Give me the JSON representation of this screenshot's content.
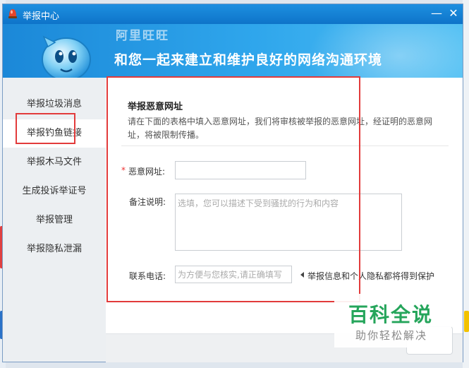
{
  "window": {
    "title": "举报中心",
    "minimize_glyph": "—",
    "close_glyph": "✕"
  },
  "banner": {
    "line1_partial": "阿里旺旺",
    "slogan": "和您一起来建立和维护良好的网络沟通环境"
  },
  "sidebar": {
    "items": [
      {
        "label": "举报垃圾消息"
      },
      {
        "label": "举报钓鱼链接"
      },
      {
        "label": "举报木马文件"
      },
      {
        "label": "生成投诉举证号"
      },
      {
        "label": "举报管理"
      },
      {
        "label": "举报隐私泄漏"
      }
    ],
    "active_index": 1
  },
  "form": {
    "section_title": "举报恶意网址",
    "description": "请在下面的表格中填入恶意网址，我们将审核被举报的恶意网址，经证明的恶意网址，将被限制传播。",
    "required_mark": "*",
    "url_label": "恶意网址:",
    "url_value": "",
    "note_label": "备注说明:",
    "note_placeholder": "选填，您可以描述下受到骚扰的行为和内容",
    "phone_label": "联系电话:",
    "phone_placeholder": "为方便与您核实,请正确填写",
    "privacy_notice": "举报信息和个人隐私都将得到保护"
  },
  "watermark": {
    "big": "百科全说",
    "small": "助你轻松解决"
  },
  "colors": {
    "titlebar": "#0e74c9",
    "highlight_box": "#e23b3b",
    "required": "#e33333",
    "watermark_green": "#25a55b"
  }
}
